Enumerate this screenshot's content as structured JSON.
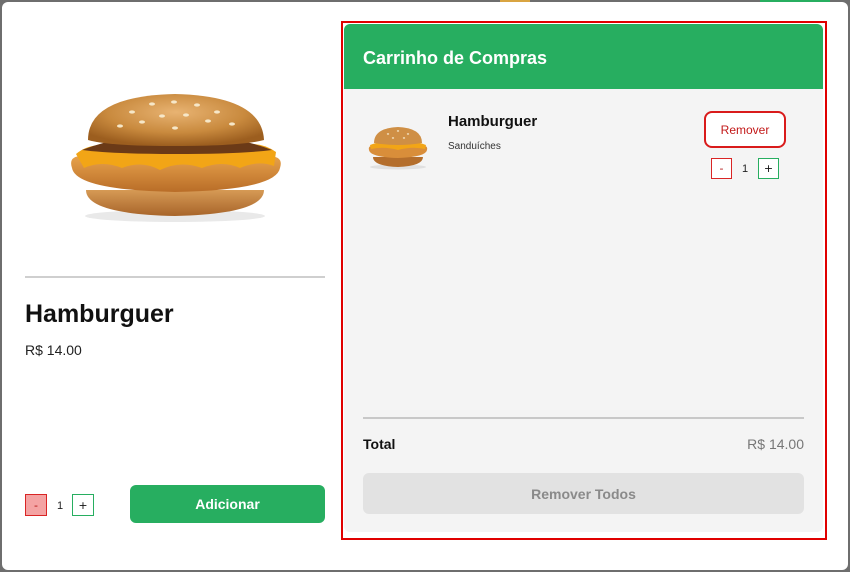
{
  "product": {
    "name": "Hamburguer",
    "price": "R$ 14.00",
    "quantity": "1",
    "decrement_label": "-",
    "increment_label": "+",
    "add_label": "Adicionar"
  },
  "cart": {
    "title": "Carrinho de Compras",
    "items": [
      {
        "name": "Hamburguer",
        "category": "Sanduíches",
        "quantity": "1",
        "remove_label": "Remover",
        "decrement_label": "-",
        "increment_label": "+"
      }
    ],
    "total_label": "Total",
    "total_value": "R$ 14.00",
    "remove_all_label": "Remover Todos"
  },
  "colors": {
    "primary_green": "#27ae60",
    "danger_red": "#d91b1b",
    "highlight_red": "#e00000"
  },
  "icons": {
    "product_image": "hamburger-image",
    "cart_thumbnail": "hamburger-image"
  }
}
